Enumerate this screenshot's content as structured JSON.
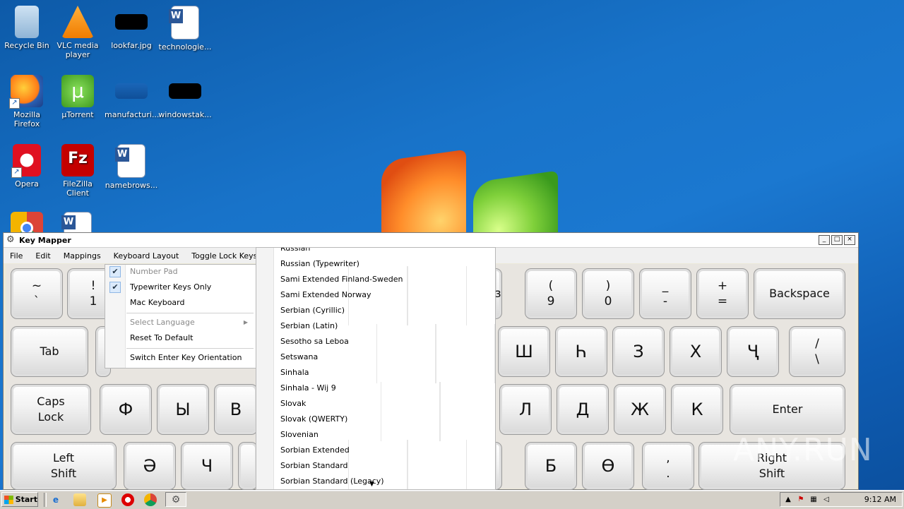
{
  "desktop": {
    "icons": [
      {
        "label": "Recycle Bin",
        "icon": "recycle-bin-icon"
      },
      {
        "label": "VLC media player",
        "icon": "vlc-icon"
      },
      {
        "label": "lookfar.jpg",
        "icon": "image-file-icon"
      },
      {
        "label": "technologie...",
        "icon": "word-doc-icon"
      },
      {
        "label": "Mozilla Firefox",
        "icon": "firefox-icon"
      },
      {
        "label": "µTorrent",
        "icon": "utorrent-icon"
      },
      {
        "label": "manufacturi...",
        "icon": "image-file-icon"
      },
      {
        "label": "windowstak...",
        "icon": "image-file-icon"
      },
      {
        "label": "Opera",
        "icon": "opera-icon"
      },
      {
        "label": "FileZilla Client",
        "icon": "filezilla-icon"
      },
      {
        "label": "namebrows...",
        "icon": "word-doc-icon"
      },
      {
        "label": "",
        "icon": "chrome-icon"
      },
      {
        "label": "",
        "icon": "word-doc-icon"
      }
    ]
  },
  "window": {
    "title": "Key Mapper",
    "controls": {
      "minimize": "_",
      "maximize": "□",
      "close": "×"
    },
    "menu": [
      "File",
      "Edit",
      "Mappings",
      "Keyboard Layout",
      "Toggle Lock Keys"
    ]
  },
  "keys": [
    {
      "top": "~",
      "bottom": "`"
    },
    {
      "top": "!",
      "bottom": "1"
    },
    {
      "top": "(",
      "bottom": "9"
    },
    {
      "top": ")",
      "bottom": "0"
    },
    {
      "top": "_",
      "bottom": "-"
    },
    {
      "top": "+",
      "bottom": "="
    },
    {
      "label": "Backspace"
    },
    {
      "label": "Tab"
    },
    {
      "label": "Ш"
    },
    {
      "label": "Һ"
    },
    {
      "label": "З"
    },
    {
      "label": "Х"
    },
    {
      "label": "Ҷ"
    },
    {
      "top": "/",
      "bottom": "\\"
    },
    {
      "label": "Caps\nLock"
    },
    {
      "label": "Ф"
    },
    {
      "label": "Ы"
    },
    {
      "label": "В"
    },
    {
      "label": "Л"
    },
    {
      "label": "Д"
    },
    {
      "label": "Ж"
    },
    {
      "label": "К"
    },
    {
      "label": "Enter"
    },
    {
      "label": "Left\nShift"
    },
    {
      "label": "Ә"
    },
    {
      "label": "Ч"
    },
    {
      "label": "Б"
    },
    {
      "label": "Ө"
    },
    {
      "top": ",",
      "bottom": "."
    },
    {
      "label": "Right\nShift"
    }
  ],
  "partial_key_glyph": "з",
  "context_menu": {
    "items": [
      {
        "label": "Number Pad",
        "disabled": true,
        "checked": true
      },
      {
        "label": "Typewriter Keys Only",
        "checked": true
      },
      {
        "label": "Mac Keyboard"
      },
      {
        "label": "Select Language",
        "disabled": true,
        "submenu": true
      },
      {
        "label": "Reset To Default"
      },
      {
        "label": "Switch Enter Key Orientation"
      }
    ],
    "submenu_arrow": "▶",
    "check_glyph": "✔"
  },
  "language_submenu": {
    "items": [
      "Russian",
      "Russian (Typewriter)",
      "Sami Extended Finland-Sweden",
      "Sami Extended Norway",
      "Serbian (Cyrillic)",
      "Serbian (Latin)",
      "Sesotho sa Leboa",
      "Setswana",
      "Sinhala",
      "Sinhala - Wij 9",
      "Slovak",
      "Slovak (QWERTY)",
      "Slovenian",
      "Sorbian Extended",
      "Sorbian Standard",
      "Sorbian Standard (Legacy)"
    ],
    "scroll_arrow": "▼"
  },
  "watermark": "ANY.RUN",
  "taskbar": {
    "start_label": "Start",
    "quick_launch": [
      "internet-explorer-icon",
      "folder-icon",
      "media-player-icon",
      "opera-icon",
      "chrome-icon",
      "key-mapper-icon"
    ],
    "tray_icons": [
      "show-hidden-icon",
      "action-center-icon",
      "network-icon",
      "volume-icon"
    ],
    "clock": "9:12 AM"
  },
  "colors": {
    "desktop": "#1873c9",
    "window_bg": "#ece9d8",
    "taskbar": "#d4d0c8",
    "menu_highlight": "#dbeafb"
  }
}
